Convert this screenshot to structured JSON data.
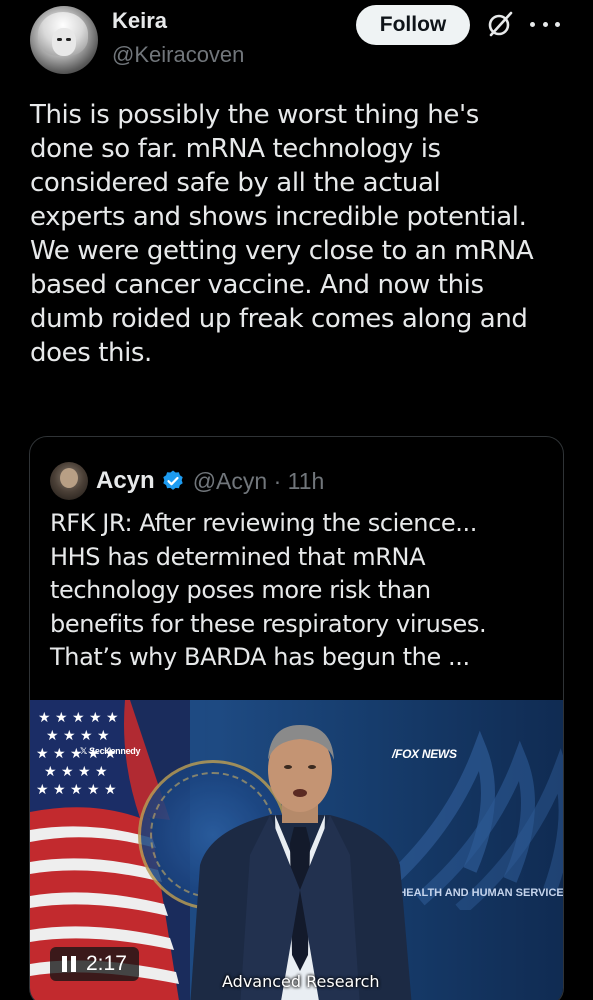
{
  "author": {
    "display_name": "Keira",
    "handle": "@Keiracoven"
  },
  "actions": {
    "follow_label": "Follow",
    "grok_icon": "grok-icon",
    "more_icon": "more-options-icon"
  },
  "tweet": {
    "lines": [
      "This is possibly the worst thing he's",
      "done so far. mRNA technology is",
      "considered safe by all the actual",
      "experts and shows incredible potential.",
      "We were getting very close to an mRNA",
      "based cancer vaccine. And now this",
      "dumb roided up freak comes along and",
      "does this."
    ]
  },
  "quote": {
    "display_name": "Acyn",
    "handle": "@Acyn",
    "separator": "·",
    "time": "11h",
    "verified_color": "#1d9bf0",
    "lines": [
      "RFK JR: After reviewing the science...",
      "HHS has determined that mRNA",
      "technology poses more risk than",
      "benefits for these respiratory viruses.",
      "That’s why BARDA has begun the ..."
    ],
    "video": {
      "time": "2:17",
      "caption": "Advanced Research",
      "network": "FOX NEWS",
      "x_handle": "SecKennedy",
      "banner_text": "OF HEALTH AND HUMAN SERVICES",
      "vertical_text": "T OF HEALTH AN"
    }
  },
  "colors": {
    "background": "#000000",
    "text": "#e7e9ea",
    "secondary": "#71767b",
    "border": "#2f3336",
    "follow_bg": "#eff3f4"
  }
}
